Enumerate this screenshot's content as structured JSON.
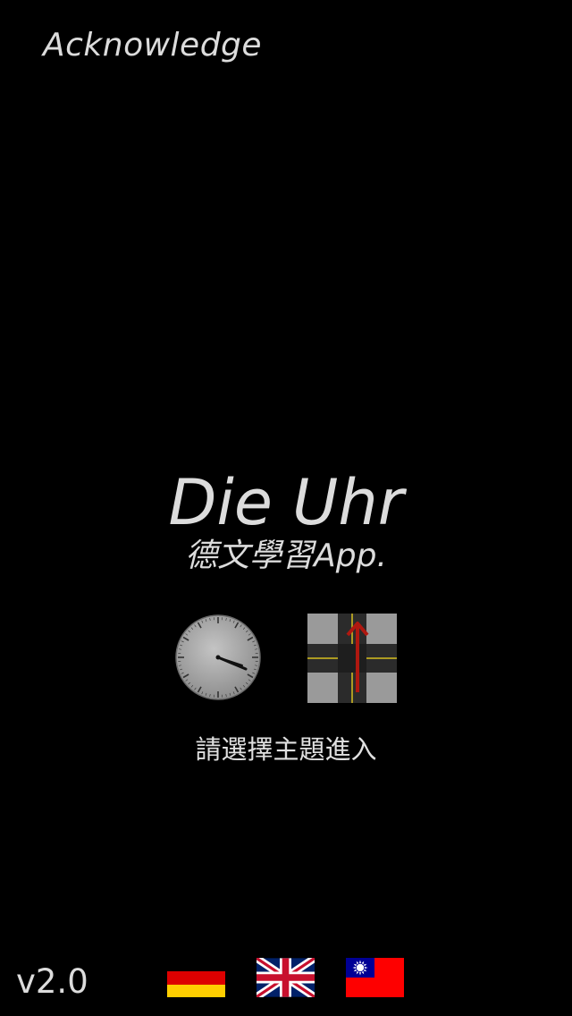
{
  "header": {
    "acknowledge_label": "Acknowledge"
  },
  "main": {
    "title": "Die Uhr",
    "subtitle": "德文學習App.",
    "prompt": "請選擇主題進入",
    "topics": [
      {
        "icon": "clock-icon",
        "time_shown": "4:22"
      },
      {
        "icon": "street-crossing-icon"
      }
    ]
  },
  "footer": {
    "version": "v2.0",
    "languages": [
      {
        "icon": "german-flag-icon"
      },
      {
        "icon": "uk-flag-icon"
      },
      {
        "icon": "taiwan-flag-icon"
      }
    ]
  },
  "colors": {
    "background": "#000000",
    "text": "#dcdcdc",
    "road_marking": "#e0c020",
    "arrow": "#b01810"
  }
}
